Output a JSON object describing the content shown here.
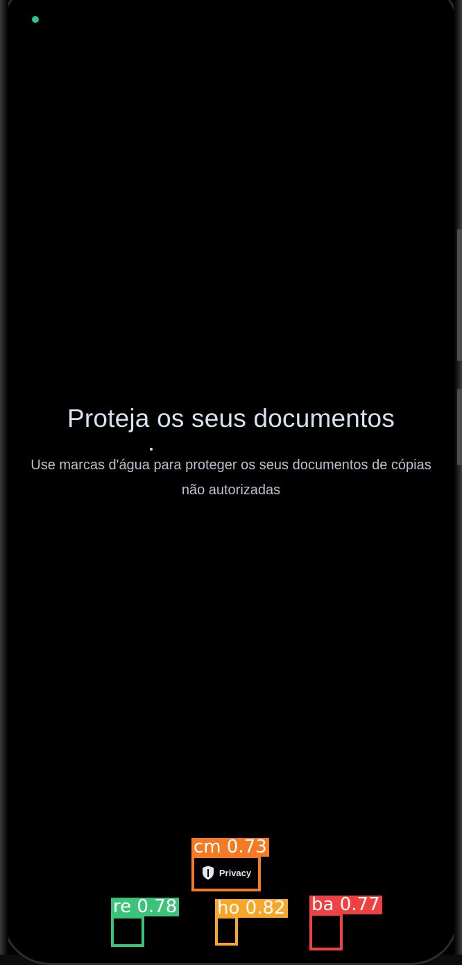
{
  "screen": {
    "title": "Proteja os seus documentos",
    "description": "Use marcas d'água para proteger os seus documentos de cópias não autorizadas"
  },
  "status": {
    "led_color": "#2dbf9a"
  },
  "privacy_chip": {
    "icon": "shield-lock-icon",
    "label": "Privacy"
  },
  "detections": {
    "cm": {
      "label": "cm 0.73",
      "color": "#f47a23",
      "target": "privacy-chip"
    },
    "re": {
      "label": "re 0.78",
      "color": "#3cc37a",
      "target": "recents-key"
    },
    "ho": {
      "label": "ho 0.82",
      "color": "#f7a627",
      "target": "home-key"
    },
    "ba": {
      "label": "ba 0.77",
      "color": "#ef4141",
      "target": "back-key"
    }
  },
  "navigation": {
    "recents_icon": "recents-icon",
    "home_icon": "home-icon",
    "back_icon": "back-icon"
  }
}
